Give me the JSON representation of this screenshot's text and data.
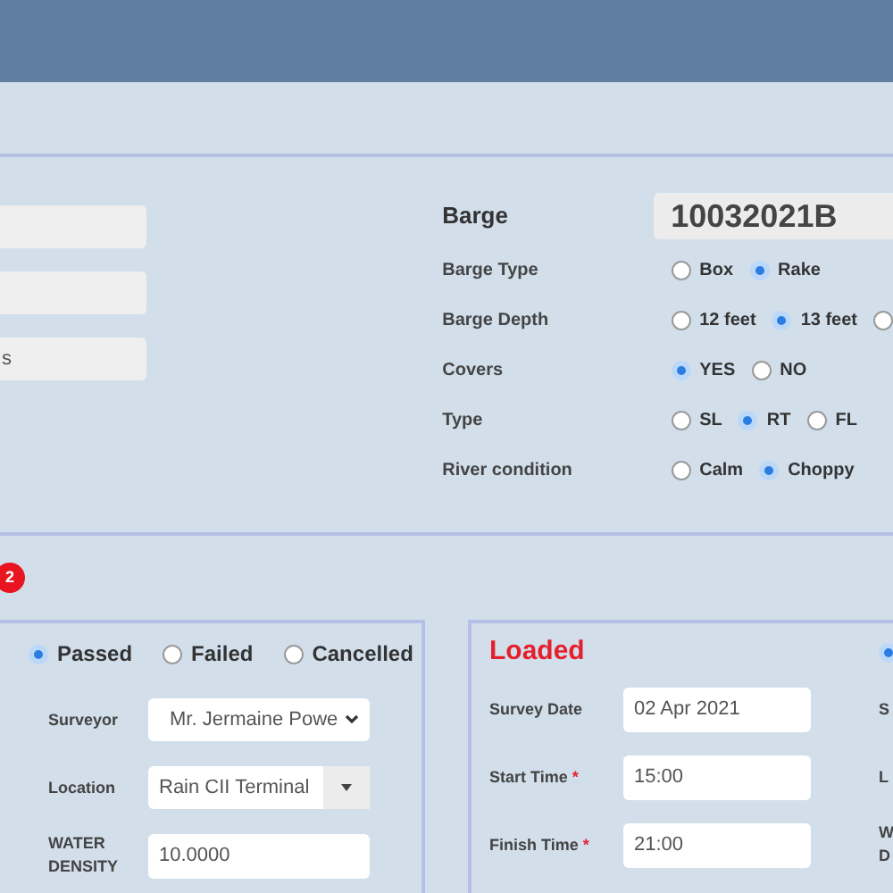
{
  "upper_panel": {
    "left_fields": [
      {
        "kind": "blank"
      },
      {
        "kind": "blank"
      },
      {
        "kind": "text",
        "value": "s"
      }
    ],
    "barge": {
      "label": "Barge",
      "value": "10032021B"
    },
    "radio_rows": [
      {
        "label": "Barge Type",
        "options": [
          {
            "label": "Box",
            "selected": false
          },
          {
            "label": "Rake",
            "selected": true
          }
        ]
      },
      {
        "label": "Barge Depth",
        "options": [
          {
            "label": "12 feet",
            "selected": false
          },
          {
            "label": "13 feet",
            "selected": true
          },
          {
            "selected": false
          }
        ]
      },
      {
        "label": "Covers",
        "options": [
          {
            "label": "YES",
            "selected": true
          },
          {
            "label": "NO",
            "selected": false
          }
        ]
      },
      {
        "label": "Type",
        "options": [
          {
            "label": "SL",
            "selected": false
          },
          {
            "label": "RT",
            "selected": true
          },
          {
            "label": "FL",
            "selected": false
          }
        ]
      },
      {
        "label": "River condition",
        "options": [
          {
            "label": "Calm",
            "selected": false
          },
          {
            "label": "Choppy",
            "selected": true
          }
        ]
      }
    ]
  },
  "badge": "2",
  "left_card": {
    "status_options": [
      {
        "label": "Passed",
        "selected": true
      },
      {
        "label": "Failed",
        "selected": false
      },
      {
        "label": "Cancelled",
        "selected": false
      }
    ],
    "fields": [
      {
        "kind": "select",
        "label": "Surveyor",
        "value": "Mr. Jermaine Powe"
      },
      {
        "kind": "combo",
        "label": "Location",
        "value": "Rain CII Terminal"
      },
      {
        "kind": "input",
        "label": "WATER DENSITY",
        "value": "10.0000"
      }
    ]
  },
  "right_card": {
    "title": "Loaded",
    "status_option": {
      "selected": true
    },
    "fields": [
      {
        "label": "Survey Date",
        "value": "02 Apr 2021"
      },
      {
        "label": "Start Time",
        "required_mark": "*",
        "value": "15:00"
      },
      {
        "label": "Finish Time",
        "required_mark": "*",
        "value": "21:00"
      }
    ],
    "side_labels": [
      "S",
      "L",
      "W D"
    ]
  }
}
